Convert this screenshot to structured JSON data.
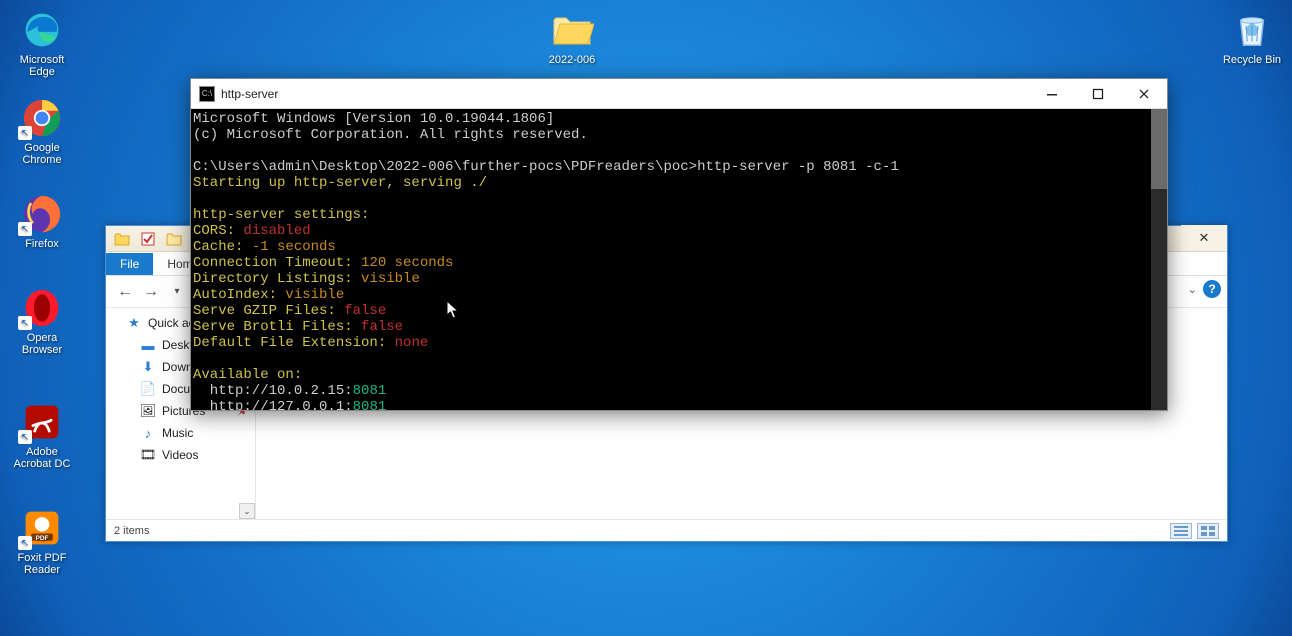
{
  "desktop": {
    "icons": [
      {
        "id": "edge",
        "label": "Microsoft\nEdge"
      },
      {
        "id": "chrome",
        "label": "Google\nChrome"
      },
      {
        "id": "firefox",
        "label": "Firefox"
      },
      {
        "id": "opera",
        "label": "Opera\nBrowser"
      },
      {
        "id": "acrobat",
        "label": "Adobe\nAcrobat DC"
      },
      {
        "id": "foxit",
        "label": "Foxit PDF\nReader"
      }
    ],
    "folder_center": {
      "label": "2022-006"
    },
    "recycle_bin": {
      "label": "Recycle Bin"
    }
  },
  "explorer": {
    "tabs": {
      "file": "File",
      "home": "Home"
    },
    "sidebar": {
      "quick_access": "Quick access",
      "desktop": "Desktop",
      "downloads": "Downloads",
      "documents": "Documents",
      "pictures": "Pictures",
      "music": "Music",
      "videos": "Videos"
    },
    "status": "2 items"
  },
  "terminal": {
    "title": "http-server",
    "lines": {
      "l1": "Microsoft Windows [Version 10.0.19044.1806]",
      "l2": "(c) Microsoft Corporation. All rights reserved.",
      "l3": "",
      "prompt": "C:\\Users\\admin\\Desktop\\2022-006\\further-pocs\\PDFreaders\\poc>",
      "cmd": "http-server -p 8081 -c-1",
      "start": "Starting up http-server, serving ./",
      "settings_hdr": "http-server settings:",
      "s_cors_k": "CORS:",
      "s_cors_v": " disabled",
      "s_cache_k": "Cache:",
      "s_cache_v": " -1 seconds",
      "s_ct_k": "Connection Timeout:",
      "s_ct_v": " 120 seconds",
      "s_dl_k": "Directory Listings:",
      "s_dl_v": " visible",
      "s_ai_k": "AutoIndex:",
      "s_ai_v": " visible",
      "s_gz_k": "Serve GZIP Files:",
      "s_gz_v": " false",
      "s_br_k": "Serve Brotli Files:",
      "s_br_v": " false",
      "s_de_k": "Default File Extension:",
      "s_de_v": " none",
      "avail": "Available on:",
      "url1_pre": "  http://10.0.2.15:",
      "url1_port": "8081",
      "url2_pre": "  http://127.0.0.1:",
      "url2_port": "8081"
    }
  }
}
